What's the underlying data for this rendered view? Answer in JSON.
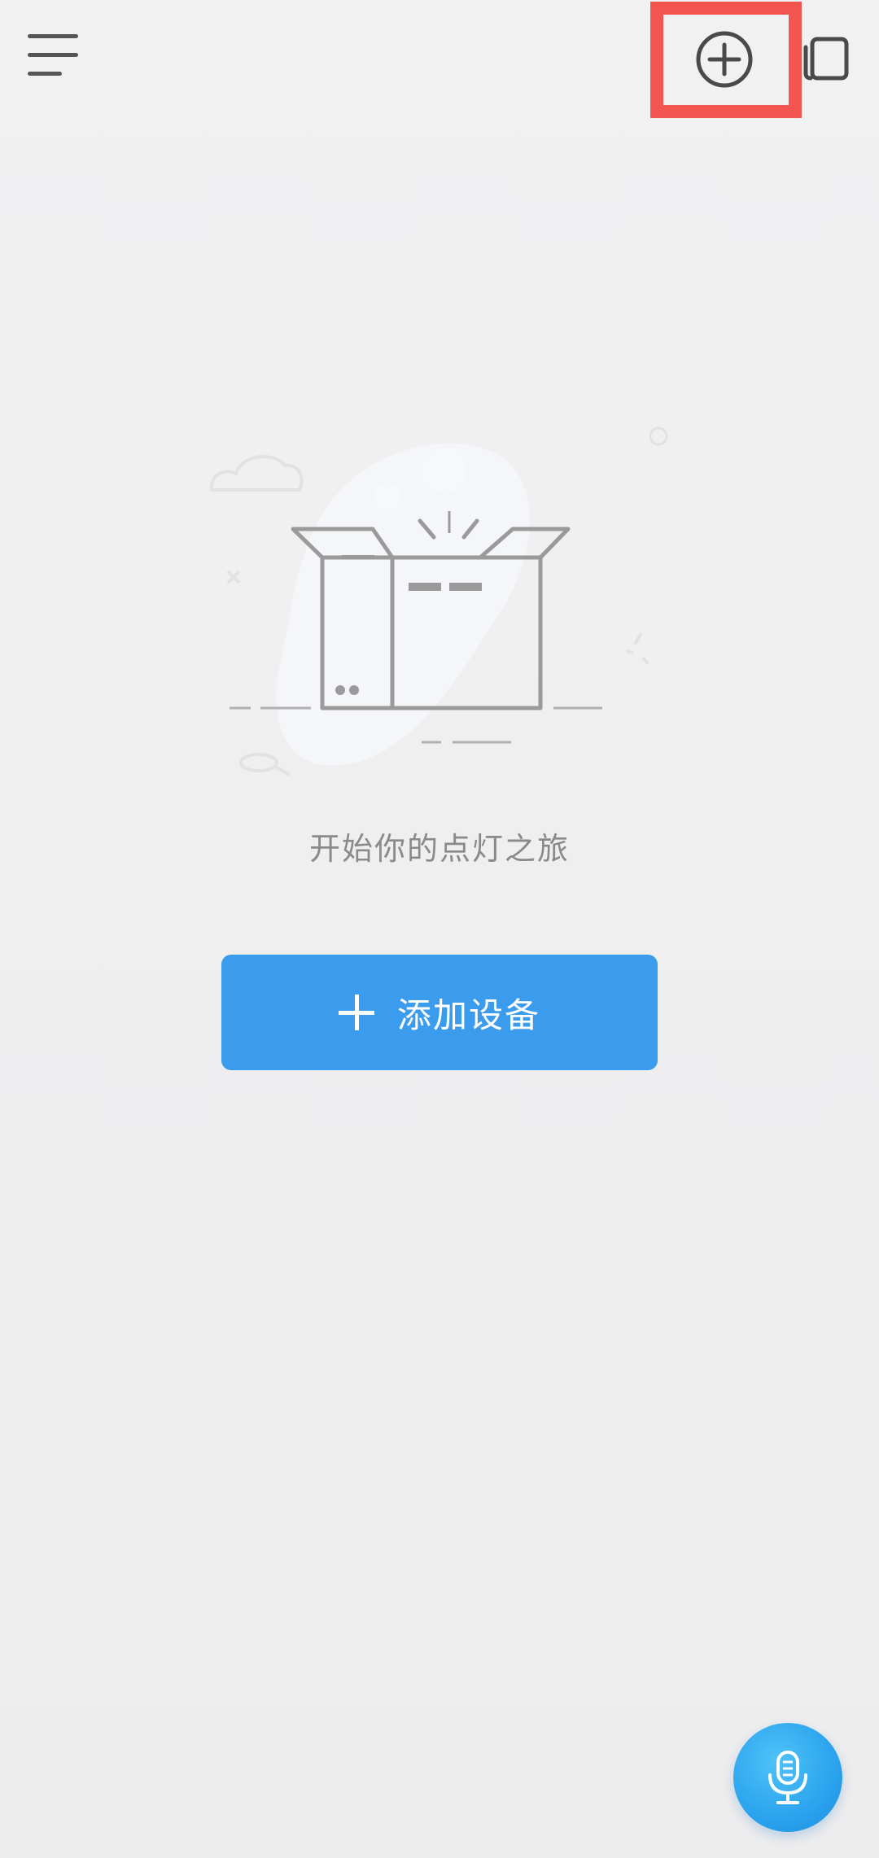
{
  "topbar": {
    "menu_icon": "hamburger-menu-icon",
    "add_icon": "plus-circle-icon",
    "devices_icon": "devices-icon",
    "highlight_color": "#f2544f"
  },
  "empty_state": {
    "illustration_icon": "empty-box-illustration",
    "message": "开始你的点灯之旅"
  },
  "add_device_button": {
    "label": "添加设备",
    "icon": "plus-icon",
    "color": "#3b9bec"
  },
  "voice_button": {
    "icon": "microphone-icon",
    "color": "#2ba3ee"
  }
}
